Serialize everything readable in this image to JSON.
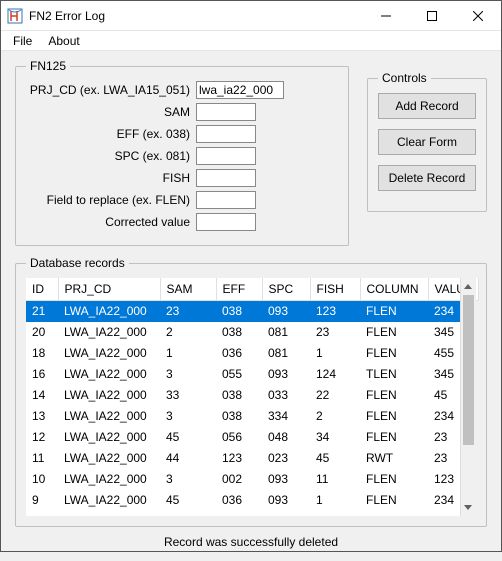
{
  "window": {
    "title": "FN2 Error Log"
  },
  "menu": {
    "file": "File",
    "about": "About"
  },
  "fn125": {
    "legend": "FN125",
    "prj_cd_label": "PRJ_CD (ex. LWA_IA15_051)",
    "prj_cd_value": "lwa_ia22_000",
    "sam_label": "SAM",
    "eff_label": "EFF (ex. 038)",
    "spc_label": "SPC (ex. 081)",
    "fish_label": "FISH",
    "field_label": "Field to replace (ex. FLEN)",
    "corrected_label": "Corrected value"
  },
  "controls": {
    "legend": "Controls",
    "add": "Add Record",
    "clear": "Clear Form",
    "delete": "Delete Record"
  },
  "db": {
    "legend": "Database records",
    "status": "Record was successfully deleted",
    "columns": {
      "id": "ID",
      "prj": "PRJ_CD",
      "sam": "SAM",
      "eff": "EFF",
      "spc": "SPC",
      "fish": "FISH",
      "col": "COLUMN",
      "val": "VALUE"
    },
    "rows": [
      {
        "id": "21",
        "prj": "LWA_IA22_000",
        "sam": "23",
        "eff": "038",
        "spc": "093",
        "fish": "123",
        "col": "FLEN",
        "val": "234",
        "selected": true
      },
      {
        "id": "20",
        "prj": "LWA_IA22_000",
        "sam": "2",
        "eff": "038",
        "spc": "081",
        "fish": "23",
        "col": "FLEN",
        "val": "345"
      },
      {
        "id": "18",
        "prj": "LWA_IA22_000",
        "sam": "1",
        "eff": "036",
        "spc": "081",
        "fish": "1",
        "col": "FLEN",
        "val": "455"
      },
      {
        "id": "16",
        "prj": "LWA_IA22_000",
        "sam": "3",
        "eff": "055",
        "spc": "093",
        "fish": "124",
        "col": "TLEN",
        "val": "345"
      },
      {
        "id": "14",
        "prj": "LWA_IA22_000",
        "sam": "33",
        "eff": "038",
        "spc": "033",
        "fish": "22",
        "col": "FLEN",
        "val": "45"
      },
      {
        "id": "13",
        "prj": "LWA_IA22_000",
        "sam": "3",
        "eff": "038",
        "spc": "334",
        "fish": "2",
        "col": "FLEN",
        "val": "234"
      },
      {
        "id": "12",
        "prj": "LWA_IA22_000",
        "sam": "45",
        "eff": "056",
        "spc": "048",
        "fish": "34",
        "col": "FLEN",
        "val": "23"
      },
      {
        "id": "11",
        "prj": "LWA_IA22_000",
        "sam": "44",
        "eff": "123",
        "spc": "023",
        "fish": "45",
        "col": "RWT",
        "val": "23"
      },
      {
        "id": "10",
        "prj": "LWA_IA22_000",
        "sam": "3",
        "eff": "002",
        "spc": "093",
        "fish": "11",
        "col": "FLEN",
        "val": "123"
      },
      {
        "id": "9",
        "prj": "LWA_IA22_000",
        "sam": "45",
        "eff": "036",
        "spc": "093",
        "fish": "1",
        "col": "FLEN",
        "val": "234"
      }
    ]
  }
}
